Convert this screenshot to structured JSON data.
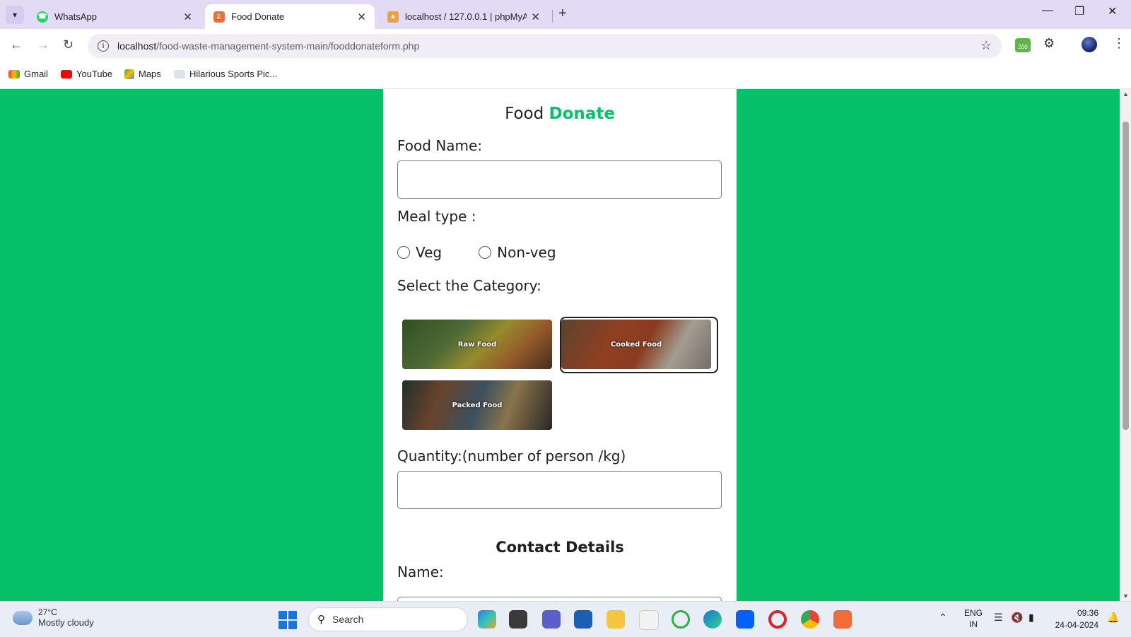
{
  "browser": {
    "tabs": [
      {
        "title": "WhatsApp",
        "active": false
      },
      {
        "title": "Food Donate",
        "active": true
      },
      {
        "title": "localhost / 127.0.0.1 | phpMyAc",
        "active": false
      }
    ],
    "url_host": "localhost",
    "url_path": "/food-waste-management-system-main/fooddonateform.php",
    "extension_badge": "200",
    "bookmarks": [
      "Gmail",
      "YouTube",
      "Maps",
      "Hilarious Sports Pic..."
    ]
  },
  "page": {
    "heading_part1": "Food",
    "heading_part2": "Donate",
    "food_name_label": "Food Name:",
    "meal_type_label": "Meal type :",
    "meal_options": [
      "Veg",
      "Non-veg"
    ],
    "category_label": "Select the Category:",
    "categories": [
      {
        "label": "Raw Food",
        "selected": false
      },
      {
        "label": "Cooked Food",
        "selected": true
      },
      {
        "label": "Packed Food",
        "selected": false
      }
    ],
    "quantity_label": "Quantity:(number of person /kg)",
    "contact_title": "Contact Details",
    "name_label": "Name:",
    "accent_color": "#06c167"
  },
  "taskbar": {
    "weather_temp": "27°C",
    "weather_condition": "Mostly cloudy",
    "search_placeholder": "Search",
    "lang_line1": "ENG",
    "lang_line2": "IN",
    "time": "09:36",
    "date": "24-04-2024"
  }
}
